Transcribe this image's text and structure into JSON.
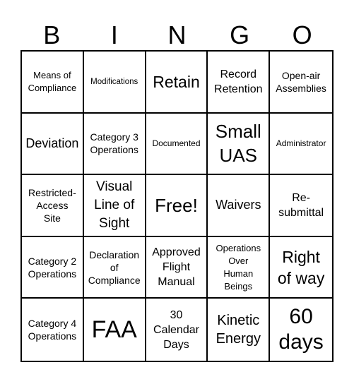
{
  "header": {
    "letters": [
      "B",
      "I",
      "N",
      "G",
      "O"
    ]
  },
  "cells": [
    [
      "Means of\nCompliance",
      "Modifications",
      "Retain",
      "Record\nRetention",
      "Open-air\nAssemblies"
    ],
    [
      "Deviation",
      "Category 3\nOperations",
      "Documented",
      "Small\nUAS",
      "Administrator"
    ],
    [
      "Restricted-\nAccess\nSite",
      "Visual\nLine of\nSight",
      "Free!",
      "Waivers",
      "Re-\nsubmittal"
    ],
    [
      "Category 2\nOperations",
      "Declaration\nof\nCompliance",
      "Approved\nFlight\nManual",
      "Operations\nOver\nHuman\nBeings",
      "Right\nof way"
    ],
    [
      "Category 4\nOperations",
      "FAA",
      "30\nCalendar\nDays",
      "Kinetic\nEnergy",
      "60\ndays"
    ]
  ]
}
